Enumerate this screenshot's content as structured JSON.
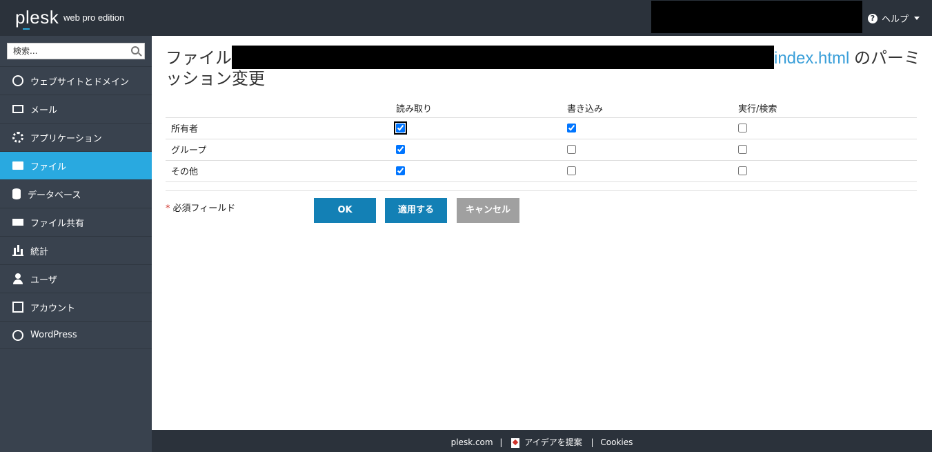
{
  "header": {
    "logo": "plesk",
    "edition": "web pro edition",
    "help_label": "ヘルプ"
  },
  "sidebar": {
    "search_placeholder": "検索...",
    "items": [
      {
        "label": "ウェブサイトとドメイン",
        "icon": "globe-icon",
        "active": false
      },
      {
        "label": "メール",
        "icon": "mail-icon",
        "active": false
      },
      {
        "label": "アプリケーション",
        "icon": "gear-icon",
        "active": false
      },
      {
        "label": "ファイル",
        "icon": "folder-icon",
        "active": true
      },
      {
        "label": "データベース",
        "icon": "database-icon",
        "active": false
      },
      {
        "label": "ファイル共有",
        "icon": "file-share-icon",
        "active": false
      },
      {
        "label": "統計",
        "icon": "stats-icon",
        "active": false
      },
      {
        "label": "ユーザ",
        "icon": "user-icon",
        "active": false
      },
      {
        "label": "アカウント",
        "icon": "account-icon",
        "active": false
      },
      {
        "label": "WordPress",
        "icon": "wordpress-icon",
        "active": false
      }
    ]
  },
  "main": {
    "title_prefix": "ファイル",
    "title_link": "index.html",
    "title_suffix": " のパーミッション変更",
    "columns": [
      "",
      "読み取り",
      "書き込み",
      "実行/検索"
    ],
    "rows": [
      {
        "label": "所有者",
        "read": true,
        "write": true,
        "execute": false
      },
      {
        "label": "グループ",
        "read": true,
        "write": false,
        "execute": false
      },
      {
        "label": "その他",
        "read": true,
        "write": false,
        "execute": false
      }
    ],
    "required_note": "必須フィールド",
    "required_star": "*",
    "buttons": {
      "ok": "OK",
      "apply": "適用する",
      "cancel": "キャンセル"
    }
  },
  "footer": {
    "site": "plesk.com",
    "idea": "アイデアを提案",
    "cookies": "Cookies"
  },
  "colors": {
    "header_bg": "#2b323b",
    "sidebar_bg": "#39424e",
    "active_item": "#29a9e0",
    "primary_button": "#1380b5",
    "cancel_button": "#a0a0a0",
    "link": "#3a9fd9"
  }
}
